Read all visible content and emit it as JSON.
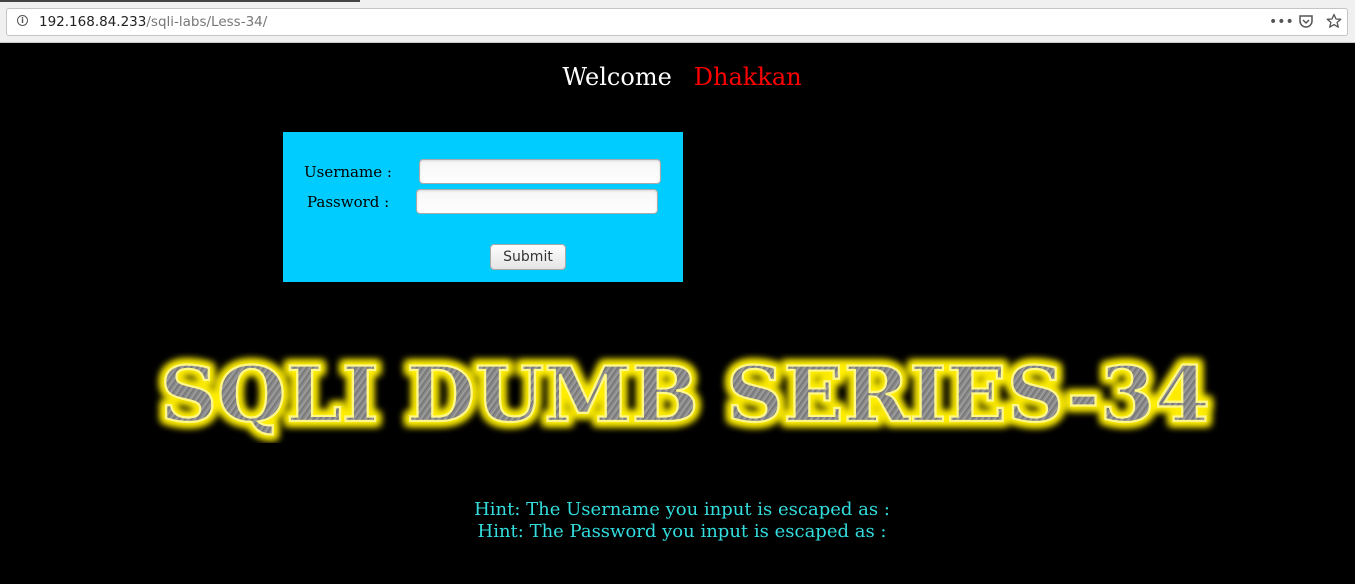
{
  "browser": {
    "url_host": "192.168.84.233",
    "url_path": "/sqli-labs/Less-34/",
    "icons": [
      "info-icon",
      "more-icon",
      "pocket-icon",
      "bookmark-star-icon"
    ]
  },
  "page": {
    "welcome_label": "Welcome",
    "welcome_name": "Dhakkan",
    "form": {
      "username_label": "Username :",
      "username_value": "",
      "password_label": "Password :",
      "password_value": "",
      "submit_label": "Submit"
    },
    "banner_text": "SQLI DUMB SERIES-34",
    "hint_username": "Hint: The Username you input is escaped as :",
    "hint_password": "Hint: The Password you input is escaped as :"
  },
  "colors": {
    "page_background": "#000000",
    "form_background": "#00ccff",
    "welcome_name": "#ff0000",
    "hint_text": "#33dddd",
    "banner_glow": "#ffee00"
  }
}
